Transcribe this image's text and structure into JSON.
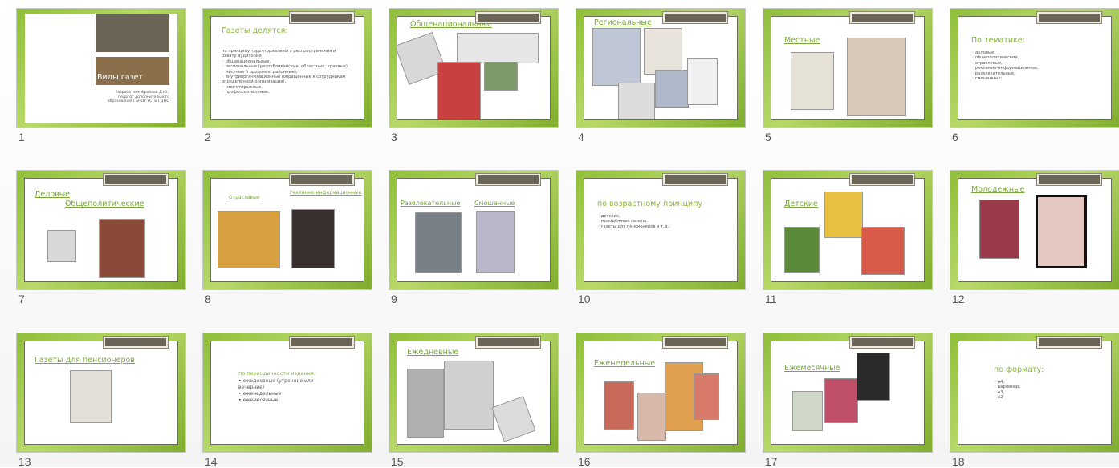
{
  "slides": [
    {
      "num": "1",
      "title": "Виды газет",
      "text": "Разработчик Фролова Д.Ю., педагог дополнительного образования ГБНОУ УСТБ ГДТЮ"
    },
    {
      "num": "2",
      "title": "Газеты делятся:",
      "intro": "по принципу территориального распространения и охвату аудитории:",
      "items": [
        "общенациональные,",
        "региональные (республиканские, областные, краевые)",
        "местные (городские, районные),",
        "внутриорганизационные (обращённые к сотрудникам определённой организации),",
        "многотиражные,",
        "профессиональные;"
      ]
    },
    {
      "num": "3",
      "title": "Общенациональные"
    },
    {
      "num": "4",
      "title": "Региональные"
    },
    {
      "num": "5",
      "title": "Местные"
    },
    {
      "num": "6",
      "title": "По тематике:",
      "items": [
        "деловые,",
        "общеполитические,",
        "отраслевые,",
        "рекламно-информационные,",
        "развлекательные,",
        "смешанные;"
      ]
    },
    {
      "num": "7",
      "title": "Деловые",
      "title2": "Общеполитические"
    },
    {
      "num": "8",
      "title": "Отраслевые",
      "title2": "Рекламно-информационные"
    },
    {
      "num": "9",
      "title": "Развлекательные",
      "title2": "Смешанные"
    },
    {
      "num": "10",
      "title": "по возрастному принципу",
      "items": [
        "детские,",
        "молодёжные газеты,",
        "газеты для пенсионеров и т.д.;"
      ]
    },
    {
      "num": "11",
      "title": "Детские"
    },
    {
      "num": "12",
      "title": "Молодежные"
    },
    {
      "num": "13",
      "title": "Газеты для пенсионеров"
    },
    {
      "num": "14",
      "title": "по периодичности издания:",
      "items": [
        "ежедневные (утренние или вечерние)",
        "еженедельные",
        "ежемесячные"
      ]
    },
    {
      "num": "15",
      "title": "Ежедневные"
    },
    {
      "num": "16",
      "title": "Еженедельные"
    },
    {
      "num": "17",
      "title": "Ежемесячные"
    },
    {
      "num": "18",
      "title": "по формату:",
      "items": [
        "А4,",
        "Берлинер,",
        "А3,",
        "А2"
      ]
    }
  ],
  "colors": {
    "green": "#8ab63a",
    "dark": "#6b6558"
  }
}
